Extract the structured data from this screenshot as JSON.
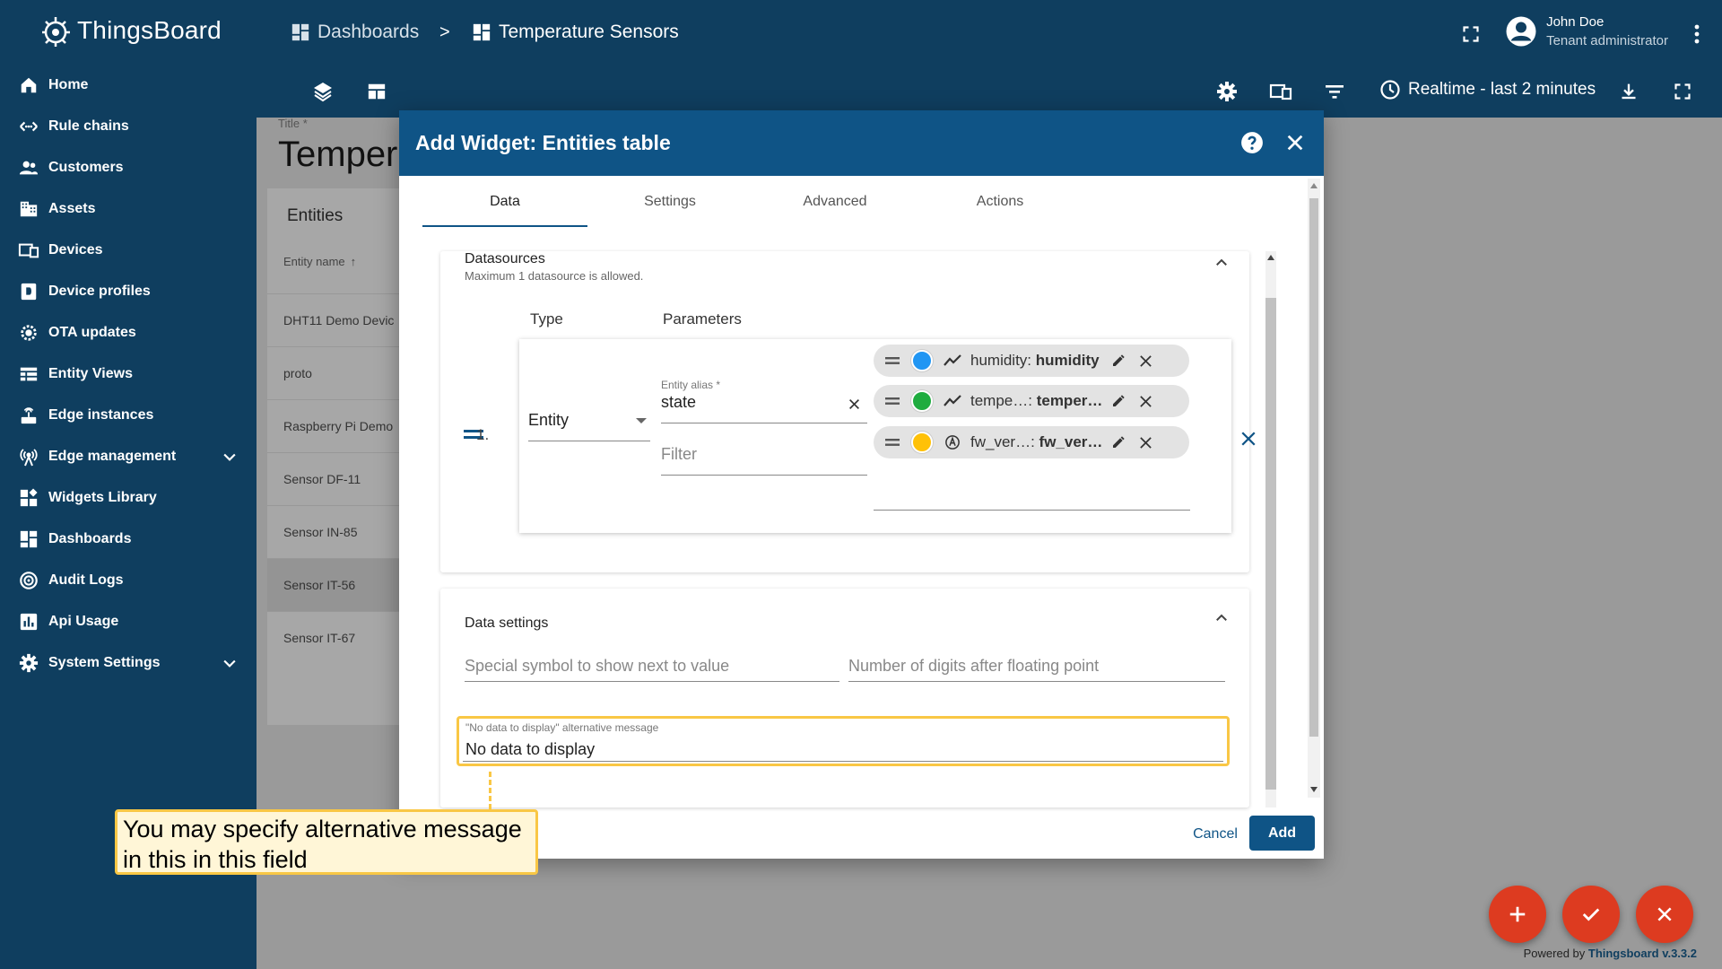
{
  "app": {
    "name": "ThingsBoard"
  },
  "sidebar": {
    "items": [
      {
        "label": "Home",
        "icon": "home-icon"
      },
      {
        "label": "Rule chains",
        "icon": "rule-chains-icon"
      },
      {
        "label": "Customers",
        "icon": "customers-icon"
      },
      {
        "label": "Assets",
        "icon": "assets-icon"
      },
      {
        "label": "Devices",
        "icon": "devices-icon"
      },
      {
        "label": "Device profiles",
        "icon": "device-profiles-icon"
      },
      {
        "label": "OTA updates",
        "icon": "ota-updates-icon"
      },
      {
        "label": "Entity Views",
        "icon": "entity-views-icon"
      },
      {
        "label": "Edge instances",
        "icon": "edge-instances-icon"
      },
      {
        "label": "Edge management",
        "icon": "edge-management-icon",
        "expandable": true
      },
      {
        "label": "Widgets Library",
        "icon": "widgets-library-icon"
      },
      {
        "label": "Dashboards",
        "icon": "dashboards-icon"
      },
      {
        "label": "Audit Logs",
        "icon": "audit-logs-icon"
      },
      {
        "label": "Api Usage",
        "icon": "api-usage-icon"
      },
      {
        "label": "System Settings",
        "icon": "system-settings-icon",
        "expandable": true
      }
    ]
  },
  "header": {
    "breadcrumb": {
      "first": "Dashboards",
      "separator": ">",
      "second": "Temperature Sensors"
    },
    "user": {
      "name": "John Doe",
      "role": "Tenant administrator"
    },
    "timewindow": "Realtime - last 2 minutes"
  },
  "dashboard": {
    "title_label": "Title *",
    "title": "Tempera",
    "entities_widget": {
      "title": "Entities",
      "column": "Entity name",
      "rows": [
        "DHT11 Demo Devic",
        "proto",
        "Raspberry Pi Demo",
        "Sensor DF-11",
        "Sensor IN-85",
        "Sensor IT-56",
        "Sensor IT-67"
      ],
      "selected_row": "Sensor IT-56"
    }
  },
  "dialog": {
    "title": "Add Widget: Entities table",
    "tabs": [
      "Data",
      "Settings",
      "Advanced",
      "Actions"
    ],
    "active_tab": "Data",
    "datasources": {
      "title": "Datasources",
      "subtitle": "Maximum 1 datasource is allowed.",
      "col_type": "Type",
      "col_params": "Parameters",
      "row_number": "1.",
      "type_value": "Entity",
      "alias_label": "Entity alias *",
      "alias_value": "state",
      "filter_placeholder": "Filter",
      "keys": [
        {
          "label": "humidity: ",
          "bold": "humidity",
          "color": "#2196f3",
          "type_icon": "timeseries-icon"
        },
        {
          "label": "tempe…: ",
          "bold": "temper…",
          "color": "#1fac3f",
          "type_icon": "timeseries-icon"
        },
        {
          "label": "fw_ver…: ",
          "bold": "fw_ver…",
          "color": "#ffc107",
          "type_icon": "attribute-icon"
        }
      ]
    },
    "data_settings": {
      "title": "Data settings",
      "units_placeholder": "Special symbol to show next to value",
      "decimals_placeholder": "Number of digits after floating point",
      "nodata_label": "\"No data to display\" alternative message",
      "nodata_value": "No data to display"
    },
    "cancel_label": "Cancel",
    "add_label": "Add"
  },
  "callout": {
    "line1": "You may specify alternative message",
    "line2": "in this  in this field"
  },
  "footer": {
    "powered_prefix": "Powered by ",
    "powered_brand": "Thingsboard v.3.3.2"
  },
  "colors": {
    "nav": "#0f3e5f",
    "primary": "#0f5486",
    "fab": "#dd3b20",
    "highlight": "#f9c745"
  }
}
